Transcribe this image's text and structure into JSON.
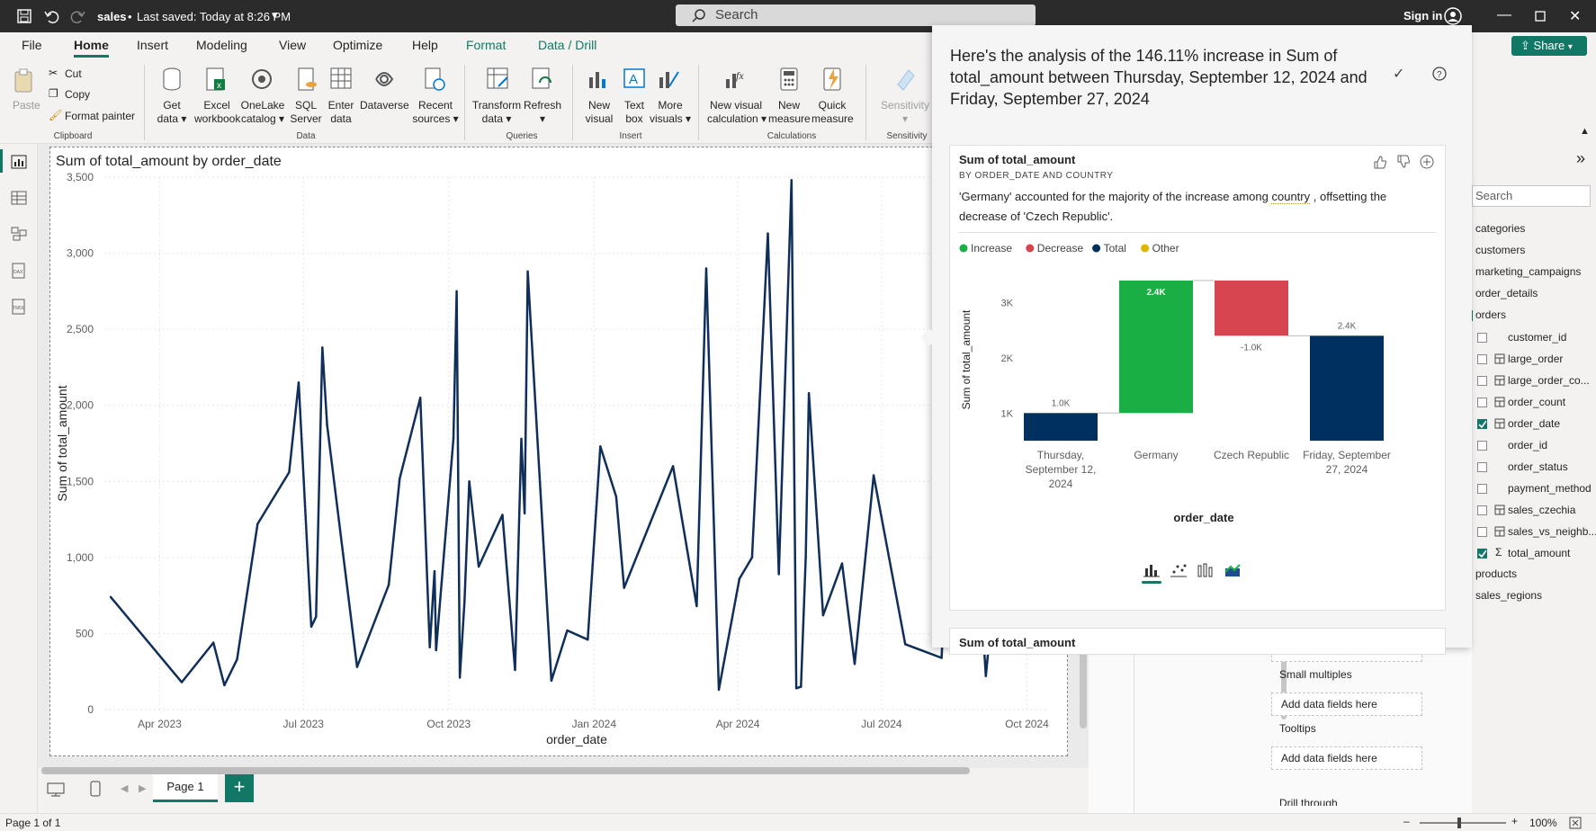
{
  "title_bar": {
    "file_name": "sales",
    "saved_status": "Last saved: Today at 8:26 PM",
    "search_placeholder": "Search",
    "sign_in": "Sign in"
  },
  "menu_tabs": [
    "File",
    "Home",
    "Insert",
    "Modeling",
    "View",
    "Optimize",
    "Help",
    "Format",
    "Data / Drill"
  ],
  "active_tab": "Home",
  "share_label": "Share",
  "ribbon": {
    "clipboard": {
      "paste": "Paste",
      "cut": "Cut",
      "copy": "Copy",
      "format_painter": "Format painter",
      "group": "Clipboard"
    },
    "data": {
      "items": [
        {
          "l1": "Get",
          "l2": "data ▾"
        },
        {
          "l1": "Excel",
          "l2": "workbook"
        },
        {
          "l1": "OneLake",
          "l2": "catalog ▾"
        },
        {
          "l1": "SQL",
          "l2": "Server"
        },
        {
          "l1": "Enter",
          "l2": "data"
        },
        {
          "l1": "Dataverse",
          "l2": ""
        },
        {
          "l1": "Recent",
          "l2": "sources ▾"
        }
      ],
      "group": "Data"
    },
    "queries": {
      "items": [
        {
          "l1": "Transform",
          "l2": "data ▾"
        },
        {
          "l1": "Refresh",
          "l2": "▾"
        }
      ],
      "group": "Queries"
    },
    "insert": {
      "items": [
        {
          "l1": "New",
          "l2": "visual"
        },
        {
          "l1": "Text",
          "l2": "box"
        },
        {
          "l1": "More",
          "l2": "visuals ▾"
        }
      ],
      "group": "Insert"
    },
    "calculations": {
      "items": [
        {
          "l1": "New visual",
          "l2": "calculation ▾"
        },
        {
          "l1": "New",
          "l2": "measure"
        },
        {
          "l1": "Quick",
          "l2": "measure"
        }
      ],
      "group": "Calculations"
    },
    "sensitivity": {
      "label": "Sensitivity",
      "group": "Sensitivity"
    }
  },
  "colors": {
    "line": "#0f2f5a",
    "increase": "#1aaf45",
    "decrease": "#d64550",
    "total": "#00305e",
    "other": "#e0b700",
    "accent": "#117865"
  },
  "chart_data": [
    {
      "type": "line",
      "title": "Sum of total_amount by order_date",
      "xlabel": "order_date",
      "ylabel": "Sum of total_amount",
      "ylim": [
        0,
        3500
      ],
      "yticks": [
        "0",
        "500",
        "1,000",
        "1,500",
        "2,000",
        "2,500",
        "3,000",
        "3,500"
      ],
      "xticks": [
        "Apr 2023",
        "Jul 2023",
        "Oct 2023",
        "Jan 2024",
        "Apr 2024",
        "Jul 2024",
        "Oct 2024"
      ],
      "grid": true,
      "series": [
        {
          "x": [
            "2023-03-01",
            "2023-04-15",
            "2023-05-05",
            "2023-05-12",
            "2023-05-20",
            "2023-06-02",
            "2023-06-22",
            "2023-06-28",
            "2023-07-06",
            "2023-07-09",
            "2023-07-13",
            "2023-07-16",
            "2023-08-04",
            "2023-08-24",
            "2023-08-31",
            "2023-09-13",
            "2023-09-19",
            "2023-09-22",
            "2023-09-23",
            "2023-10-04",
            "2023-10-06",
            "2023-10-08",
            "2023-10-11",
            "2023-10-14",
            "2023-10-20",
            "2023-11-04",
            "2023-11-12",
            "2023-11-16",
            "2023-11-18",
            "2023-11-20",
            "2023-12-05",
            "2023-12-15",
            "2023-12-28",
            "2024-01-05",
            "2024-01-15",
            "2024-01-20",
            "2024-02-20",
            "2024-03-06",
            "2024-03-12",
            "2024-03-20",
            "2024-04-02",
            "2024-04-10",
            "2024-04-20",
            "2024-04-27",
            "2024-05-05",
            "2024-05-08",
            "2024-05-11",
            "2024-05-14",
            "2024-05-16",
            "2024-05-25",
            "2024-06-06",
            "2024-06-14",
            "2024-06-26",
            "2024-07-16",
            "2024-08-08",
            "2024-08-20",
            "2024-09-05",
            "2024-09-12",
            "2024-09-20",
            "2024-09-27",
            "2024-10-06",
            "2024-10-13"
          ],
          "y": [
            740,
            180,
            440,
            160,
            330,
            1220,
            1560,
            2150,
            545,
            610,
            2380,
            1870,
            280,
            820,
            1520,
            2050,
            410,
            910,
            390,
            1780,
            2750,
            210,
            710,
            1500,
            940,
            1280,
            260,
            1780,
            1290,
            2880,
            190,
            520,
            460,
            1730,
            1400,
            800,
            1600,
            680,
            2900,
            130,
            860,
            1000,
            3130,
            890,
            3480,
            140,
            150,
            1000,
            2080,
            620,
            960,
            300,
            1540,
            430,
            340,
            2860,
            220,
            980,
            1310,
            2430,
            2100,
            1680
          ]
        }
      ]
    },
    {
      "type": "bar",
      "title": "Sum of total_amount",
      "subtitle": "BY ORDER_DATE AND COUNTRY",
      "xlabel": "order_date",
      "ylabel": "Sum of total_amount",
      "ylim": [
        500,
        3500
      ],
      "yticks": [
        "1K",
        "2K",
        "3K"
      ],
      "legend": [
        "Increase",
        "Decrease",
        "Total",
        "Other"
      ],
      "categories": [
        "Thursday, September 12, 2024",
        "Germany",
        "Czech Republic",
        "Friday, September 27, 2024"
      ],
      "category_labels": [
        [
          "Thursday,",
          "September 12,",
          "2024"
        ],
        [
          "Germany"
        ],
        [
          "Czech Republic"
        ],
        [
          "Friday, September",
          "27, 2024"
        ]
      ],
      "waterfall": [
        {
          "start": 500,
          "end": 1000,
          "kind": "total",
          "label": "1.0K"
        },
        {
          "start": 1000,
          "end": 3400,
          "kind": "increase",
          "label": "2.4K"
        },
        {
          "start": 3400,
          "end": 2400,
          "kind": "decrease",
          "label": "-1.0K"
        },
        {
          "start": 500,
          "end": 2400,
          "kind": "total",
          "label": "2.4K"
        }
      ]
    }
  ],
  "copilot": {
    "summary": "Here's the analysis of the 146.11% increase in Sum of total_amount between Thursday, September 12, 2024 and Friday, September 27, 2024",
    "card_title": "Sum of total_amount",
    "card_subtitle": "BY ORDER_DATE AND COUNTRY",
    "insight_pre": "'Germany' accounted for the majority of the increase among ",
    "insight_link": "country",
    "insight_post": " , offsetting the decrease of 'Czech Republic'.",
    "card2_title": "Sum of total_amount"
  },
  "fields_pane": {
    "search_placeholder": "Search",
    "tables_before": [
      "categories",
      "customers",
      "marketing_campaigns",
      "order_details",
      "orders"
    ],
    "orders_fields": [
      {
        "name": "customer_id",
        "checked": false,
        "type": "none"
      },
      {
        "name": "large_order",
        "checked": false,
        "type": "calc"
      },
      {
        "name": "large_order_co...",
        "checked": false,
        "type": "calc"
      },
      {
        "name": "order_count",
        "checked": false,
        "type": "calc"
      },
      {
        "name": "order_date",
        "checked": true,
        "type": "calc"
      },
      {
        "name": "order_id",
        "checked": false,
        "type": "none"
      },
      {
        "name": "order_status",
        "checked": false,
        "type": "none"
      },
      {
        "name": "payment_method",
        "checked": false,
        "type": "none"
      },
      {
        "name": "sales_czechia",
        "checked": false,
        "type": "calc"
      },
      {
        "name": "sales_vs_neighb...",
        "checked": false,
        "type": "calc"
      },
      {
        "name": "total_amount",
        "checked": true,
        "type": "sum"
      }
    ],
    "tables_after": [
      "products",
      "sales_regions"
    ]
  },
  "build_pane": {
    "add_fields": "Add data fields here",
    "small_multiples": "Small multiples",
    "tooltips": "Tooltips",
    "drill_through": "Drill through"
  },
  "page_tabs": [
    "Page 1"
  ],
  "status": {
    "page": "Page 1 of 1",
    "zoom": "100%"
  }
}
